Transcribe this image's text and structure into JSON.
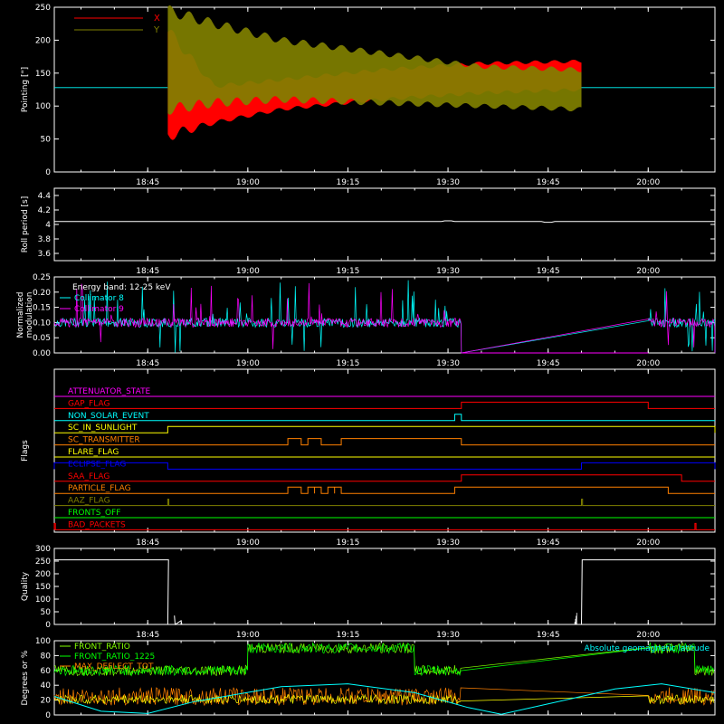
{
  "time_axis": {
    "tick_labels": [
      "18:45",
      "19:00",
      "19:15",
      "19:30",
      "19:45",
      "20:00"
    ],
    "tick_times": [
      "18:45",
      "19:00",
      "19:15",
      "19:30",
      "19:45",
      "20:00"
    ],
    "range": [
      "18:31",
      "20:10"
    ]
  },
  "colors": {
    "red": "#ff0000",
    "olive": "#808000",
    "white": "#ffffff",
    "cyan": "#00ffff",
    "magenta": "#ff00ff",
    "orange": "#ff8000",
    "yellow": "#ffff00",
    "blue": "#0000ff",
    "green": "#00ff00",
    "light_green": "#80ff00"
  },
  "chart_data": [
    {
      "id": "pointing",
      "type": "line",
      "ylabel": "Pointing [\"]",
      "ylim": [
        0,
        250
      ],
      "y_ticks": [
        0,
        50,
        100,
        150,
        200,
        250
      ],
      "legend_position": "top-left",
      "reference_level": 128,
      "series": [
        {
          "name": "X",
          "color": "#ff0000",
          "envelope": [
            {
              "t": "18:48",
              "low": 55,
              "high": 215
            },
            {
              "t": "18:55",
              "low": 75,
              "high": 130
            },
            {
              "t": "19:05",
              "low": 95,
              "high": 140
            },
            {
              "t": "19:20",
              "low": 110,
              "high": 155
            },
            {
              "t": "19:35",
              "low": 120,
              "high": 165
            },
            {
              "t": "19:50",
              "low": 125,
              "high": 168
            }
          ]
        },
        {
          "name": "Y",
          "color": "#808000",
          "envelope": [
            {
              "t": "18:48",
              "low": 95,
              "high": 245
            },
            {
              "t": "18:55",
              "low": 105,
              "high": 225
            },
            {
              "t": "19:05",
              "low": 110,
              "high": 200
            },
            {
              "t": "19:20",
              "low": 105,
              "high": 180
            },
            {
              "t": "19:35",
              "low": 100,
              "high": 160
            },
            {
              "t": "19:50",
              "low": 95,
              "high": 155
            }
          ]
        }
      ]
    },
    {
      "id": "roll",
      "type": "line",
      "ylabel": "Roll period [s]",
      "ylim": [
        3.5,
        4.5
      ],
      "y_ticks": [
        3.6,
        3.8,
        4.0,
        4.2,
        4.4
      ],
      "series": [
        {
          "name": "",
          "color": "#ffffff",
          "value": 4.04
        }
      ]
    },
    {
      "id": "modulation",
      "type": "line",
      "ylabel": [
        "Normalized",
        "modulation"
      ],
      "ylim": [
        0,
        0.25
      ],
      "y_ticks": [
        0.0,
        0.05,
        0.1,
        0.15,
        0.2,
        0.25
      ],
      "y_tick_labels": [
        "0.00",
        "0.05",
        "0.10",
        "0.15",
        "0.20",
        "0.25"
      ],
      "annotation": "Energy band: 12-25 keV",
      "series": [
        {
          "name": "Collimator 8",
          "color": "#00ffff"
        },
        {
          "name": "Collimator 9",
          "color": "#ff00ff"
        }
      ],
      "active_intervals": [
        [
          "18:31",
          "19:32"
        ],
        [
          "20:00",
          "20:10"
        ]
      ],
      "base_level": 0.1
    },
    {
      "id": "flags",
      "type": "line",
      "ylabel": "Flags",
      "flags": [
        {
          "name": "ATTENUATOR_STATE",
          "color": "#ff00ff",
          "high": []
        },
        {
          "name": "GAP_FLAG",
          "color": "#ff0000",
          "high": [
            [
              "19:32",
              "20:00"
            ]
          ]
        },
        {
          "name": "NON_SOLAR_EVENT",
          "color": "#00ffff",
          "high": [
            [
              "19:31",
              "19:32"
            ]
          ]
        },
        {
          "name": "SC_IN_SUNLIGHT",
          "color": "#ffff00",
          "high": [
            [
              "18:48",
              "20:10"
            ]
          ]
        },
        {
          "name": "SC_TRANSMITTER",
          "color": "#ff8000",
          "high": [
            [
              "19:06",
              "19:08"
            ],
            [
              "19:09",
              "19:11"
            ],
            [
              "19:14",
              "19:32"
            ]
          ]
        },
        {
          "name": "FLARE_FLAG",
          "color": "#ffff00",
          "high": []
        },
        {
          "name": "ECLIPSE_FLAG",
          "color": "#0000ff",
          "high": [
            [
              "18:31",
              "18:48"
            ],
            [
              "19:50",
              "20:10"
            ]
          ]
        },
        {
          "name": "SAA_FLAG",
          "color": "#ff0000",
          "high": [
            [
              "19:32",
              "20:05"
            ]
          ]
        },
        {
          "name": "PARTICLE_FLAG",
          "color": "#ff8000",
          "high": [
            [
              "19:06",
              "19:08"
            ],
            [
              "19:09",
              "19:10"
            ],
            [
              "19:10",
              "19:11"
            ],
            [
              "19:12",
              "19:13"
            ],
            [
              "19:13",
              "19:14"
            ],
            [
              "19:31",
              "20:03"
            ]
          ]
        },
        {
          "name": "AAZ_FLAG",
          "color": "#808000",
          "high": [
            [
              "18:48",
              "18:48"
            ],
            [
              "19:50",
              "19:50"
            ]
          ]
        },
        {
          "name": "FRONTS_OFF",
          "color": "#00ff00",
          "high": []
        },
        {
          "name": "BAD_PACKETS",
          "color": "#ff0000",
          "high": [
            [
              "18:31",
              "18:31"
            ],
            [
              "20:07",
              "20:07"
            ]
          ]
        }
      ]
    },
    {
      "id": "quality",
      "type": "line",
      "ylabel": "Quality",
      "ylim": [
        0,
        300
      ],
      "y_ticks": [
        0,
        50,
        100,
        150,
        200,
        250,
        300
      ],
      "series": [
        {
          "name": "",
          "color": "#ffffff",
          "points": [
            {
              "t": "18:31",
              "y": 255
            },
            {
              "t": "18:48",
              "y": 255
            },
            {
              "t": "18:48",
              "y": 0
            },
            {
              "t": "18:49",
              "y": 0
            },
            {
              "t": "18:49",
              "y": 35
            },
            {
              "t": "18:49",
              "y": 0
            },
            {
              "t": "18:50",
              "y": 15
            },
            {
              "t": "18:50",
              "y": 0
            },
            {
              "t": "19:50",
              "y": 0
            },
            {
              "t": "19:50",
              "y": 255
            },
            {
              "t": "20:10",
              "y": 255
            }
          ]
        }
      ]
    },
    {
      "id": "ratios",
      "type": "line",
      "ylabel": "Degrees or %",
      "ylim": [
        0,
        100
      ],
      "y_ticks": [
        0,
        20,
        40,
        60,
        80,
        100
      ],
      "series": [
        {
          "name": "FRONT_RATIO",
          "color": "#80ff00"
        },
        {
          "name": "FRONT_RATIO_1225",
          "color": "#00ff00"
        },
        {
          "name": "MAX_DEFLECT_TOT",
          "color": "#ff8000"
        },
        {
          "name": "Absolute geomagnetic latitude",
          "color": "#00ffff"
        }
      ],
      "front_ratio_levels": [
        {
          "t0": "18:31",
          "t1": "19:00",
          "y": 60
        },
        {
          "t0": "19:00",
          "t1": "19:25",
          "y": 90
        },
        {
          "t0": "19:25",
          "t1": "19:32",
          "y": 60
        },
        {
          "t0": "20:00",
          "t1": "20:07",
          "y": 90
        },
        {
          "t0": "20:07",
          "t1": "20:10",
          "y": 60
        }
      ],
      "deflect_level": 25,
      "latitude_points": [
        {
          "t": "18:31",
          "y": 25
        },
        {
          "t": "18:38",
          "y": 5
        },
        {
          "t": "18:45",
          "y": 2
        },
        {
          "t": "18:52",
          "y": 18
        },
        {
          "t": "19:05",
          "y": 38
        },
        {
          "t": "19:15",
          "y": 42
        },
        {
          "t": "19:25",
          "y": 30
        },
        {
          "t": "19:33",
          "y": 10
        },
        {
          "t": "19:38",
          "y": 1
        },
        {
          "t": "19:45",
          "y": 15
        },
        {
          "t": "19:55",
          "y": 35
        },
        {
          "t": "20:02",
          "y": 42
        },
        {
          "t": "20:10",
          "y": 30
        }
      ]
    }
  ]
}
